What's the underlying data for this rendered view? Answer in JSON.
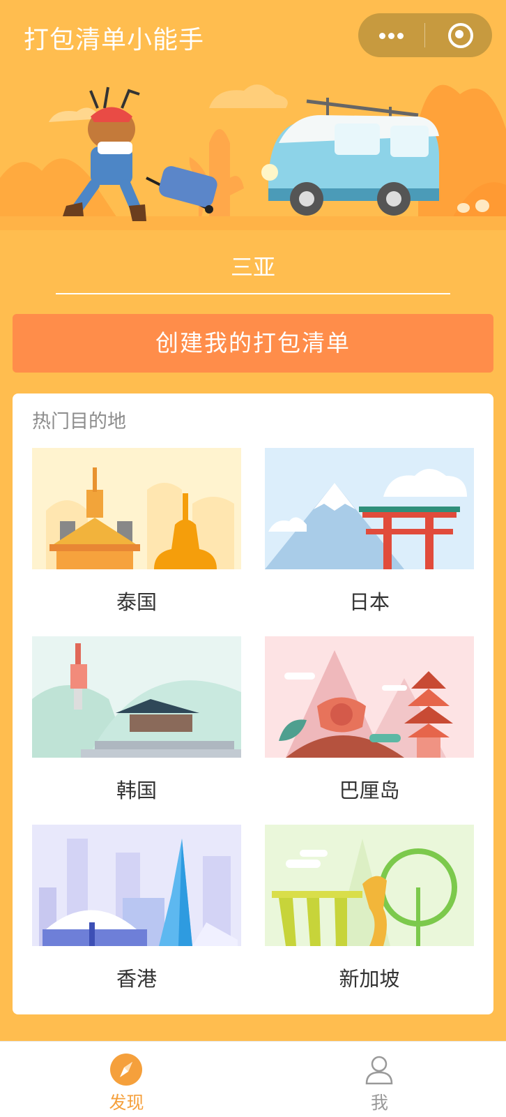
{
  "app": {
    "title": "打包清单小能手"
  },
  "capsule": {
    "more_icon": "more-dots-icon",
    "close_icon": "target-circle-icon"
  },
  "banner": {
    "illustration": "deer-with-suitcase-and-camper-van"
  },
  "destination": {
    "value": "三亚"
  },
  "actions": {
    "create_label": "创建我的打包清单"
  },
  "hot": {
    "title": "热门目的地",
    "items": [
      {
        "label": "泰国",
        "icon": "thailand-illustration"
      },
      {
        "label": "日本",
        "icon": "japan-illustration"
      },
      {
        "label": "韩国",
        "icon": "korea-illustration"
      },
      {
        "label": "巴厘岛",
        "icon": "bali-illustration"
      },
      {
        "label": "香港",
        "icon": "hongkong-illustration"
      },
      {
        "label": "新加坡",
        "icon": "singapore-illustration"
      }
    ]
  },
  "tabs": [
    {
      "label": "发现",
      "icon": "compass-icon",
      "active": true
    },
    {
      "label": "我",
      "icon": "user-icon",
      "active": false
    }
  ],
  "colors": {
    "background": "#FFBD4F",
    "accent": "#FF8D4A",
    "tab_active": "#F5A03C",
    "tab_inactive": "#999999"
  }
}
